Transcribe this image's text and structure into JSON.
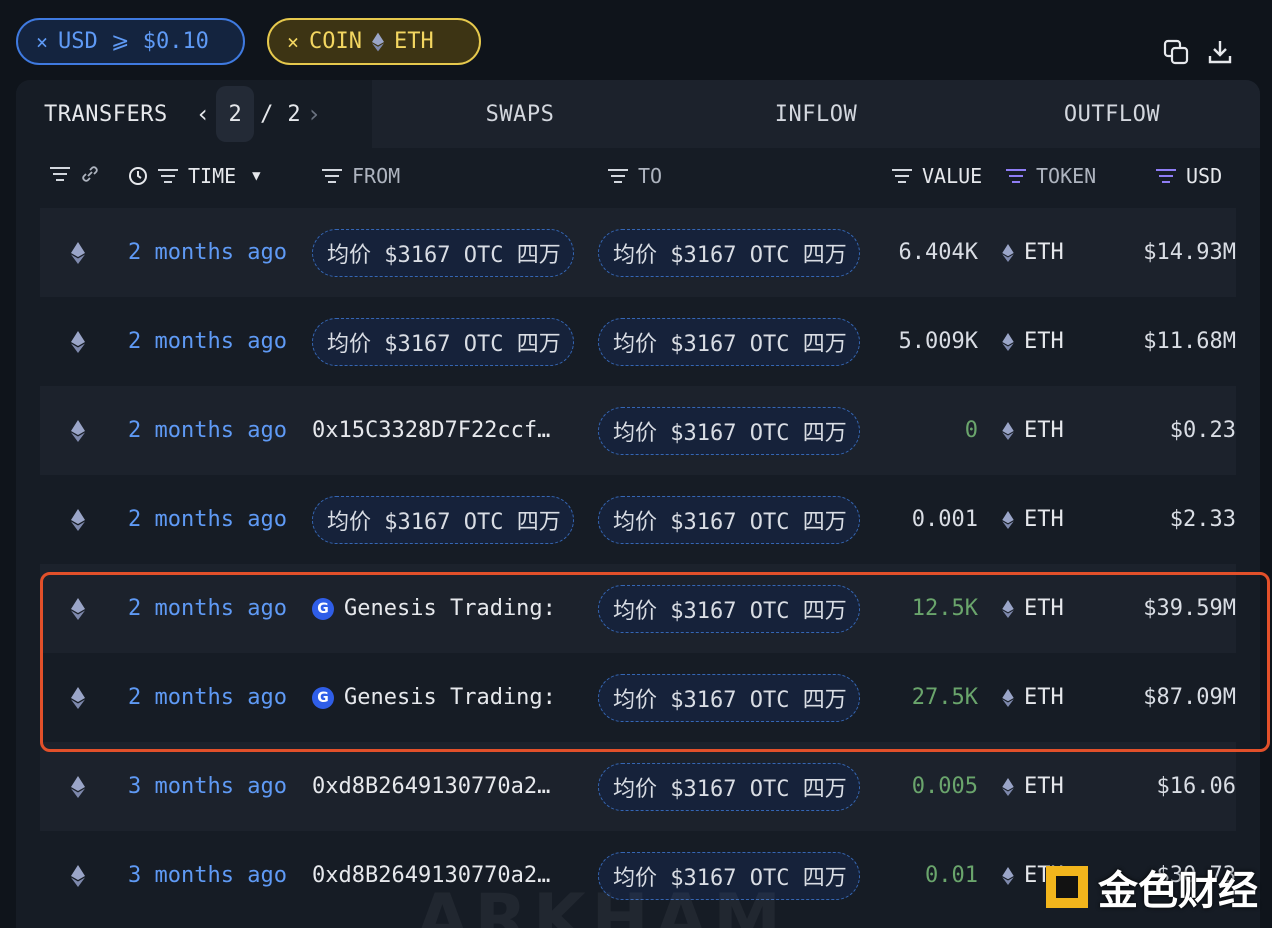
{
  "filters": [
    {
      "close": "×",
      "label": "USD ⩾ $0.10"
    },
    {
      "close": "×",
      "label_prefix": "COIN",
      "coin_icon": "eth-icon",
      "label_suffix": "ETH"
    }
  ],
  "tabs": {
    "transfers": "TRANSFERS",
    "page_current": "2",
    "page_sep": "/",
    "page_total": "2",
    "swaps": "SWAPS",
    "inflow": "INFLOW",
    "outflow": "OUTFLOW"
  },
  "columns": {
    "time": "TIME",
    "from": "FROM",
    "to": "TO",
    "value": "VALUE",
    "token": "TOKEN",
    "usd": "USD"
  },
  "rows": [
    {
      "time": "2 months ago",
      "from": "均价 $3167 OTC 四万",
      "from_type": "pill",
      "to": "均价 $3167 OTC 四万",
      "value": "6.404K",
      "value_green": false,
      "token": "ETH",
      "usd": "$14.93M"
    },
    {
      "time": "2 months ago",
      "from": "均价 $3167 OTC 四万",
      "from_type": "pill",
      "to": "均价 $3167 OTC 四万",
      "value": "5.009K",
      "value_green": false,
      "token": "ETH",
      "usd": "$11.68M"
    },
    {
      "time": "2 months ago",
      "from": "0x15C3328D7F22ccf…",
      "from_type": "addr",
      "to": "均价 $3167 OTC 四万",
      "value": "0",
      "value_green": true,
      "token": "ETH",
      "usd": "$0.23"
    },
    {
      "time": "2 months ago",
      "from": "均价 $3167 OTC 四万",
      "from_type": "pill",
      "to": "均价 $3167 OTC 四万",
      "value": "0.001",
      "value_green": false,
      "token": "ETH",
      "usd": "$2.33"
    },
    {
      "time": "2 months ago",
      "from": "Genesis Trading:",
      "from_type": "genesis",
      "to": "均价 $3167 OTC 四万",
      "value": "12.5K",
      "value_green": true,
      "token": "ETH",
      "usd": "$39.59M"
    },
    {
      "time": "2 months ago",
      "from": "Genesis Trading:",
      "from_type": "genesis",
      "to": "均价 $3167 OTC 四万",
      "value": "27.5K",
      "value_green": true,
      "token": "ETH",
      "usd": "$87.09M"
    },
    {
      "time": "3 months ago",
      "from": "0xd8B2649130770a2…",
      "from_type": "addr",
      "to": "均价 $3167 OTC 四万",
      "value": "0.005",
      "value_green": true,
      "token": "ETH",
      "usd": "$16.06"
    },
    {
      "time": "3 months ago",
      "from": "0xd8B2649130770a2…",
      "from_type": "addr",
      "to": "均价 $3167 OTC 四万",
      "value": "0.01",
      "value_green": true,
      "token": "ETH",
      "usd": "$30.73"
    }
  ],
  "genesis_logo_letter": "G",
  "watermarks": {
    "arkham": "ARKHAM",
    "jinse": "金色财经"
  },
  "colors": {
    "accent_blue": "#5f9af5",
    "coin_yellow": "#f3d661",
    "value_green": "#6aa56c",
    "highlight": "#e2502a"
  }
}
